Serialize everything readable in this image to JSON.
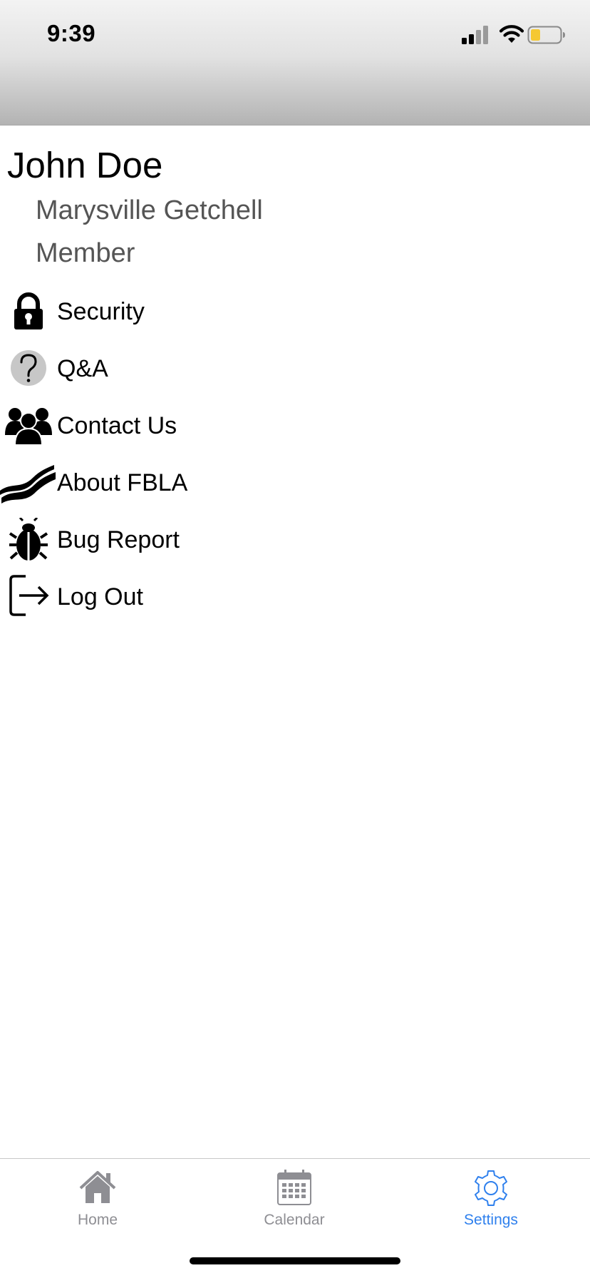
{
  "status_bar": {
    "time": "9:39",
    "signal_icon": "cellular-signal-icon",
    "wifi_icon": "wifi-icon",
    "battery_icon": "battery-low-icon",
    "battery_color": "#f5c831"
  },
  "profile": {
    "name": "John Doe",
    "school": "Marysville Getchell",
    "role": "Member"
  },
  "menu": {
    "items": [
      {
        "label": "Security",
        "icon": "lock-icon"
      },
      {
        "label": "Q&A",
        "icon": "question-mark-icon"
      },
      {
        "label": "Contact Us",
        "icon": "people-icon"
      },
      {
        "label": "About FBLA",
        "icon": "fbla-logo-icon"
      },
      {
        "label": "Bug Report",
        "icon": "bug-icon"
      },
      {
        "label": "Log Out",
        "icon": "logout-icon"
      }
    ]
  },
  "tab_bar": {
    "tabs": [
      {
        "label": "Home",
        "icon": "home-icon",
        "active": false
      },
      {
        "label": "Calendar",
        "icon": "calendar-icon",
        "active": false
      },
      {
        "label": "Settings",
        "icon": "gear-icon",
        "active": true
      }
    ],
    "active_color": "#2f80ed",
    "inactive_color": "#8e8e93"
  }
}
